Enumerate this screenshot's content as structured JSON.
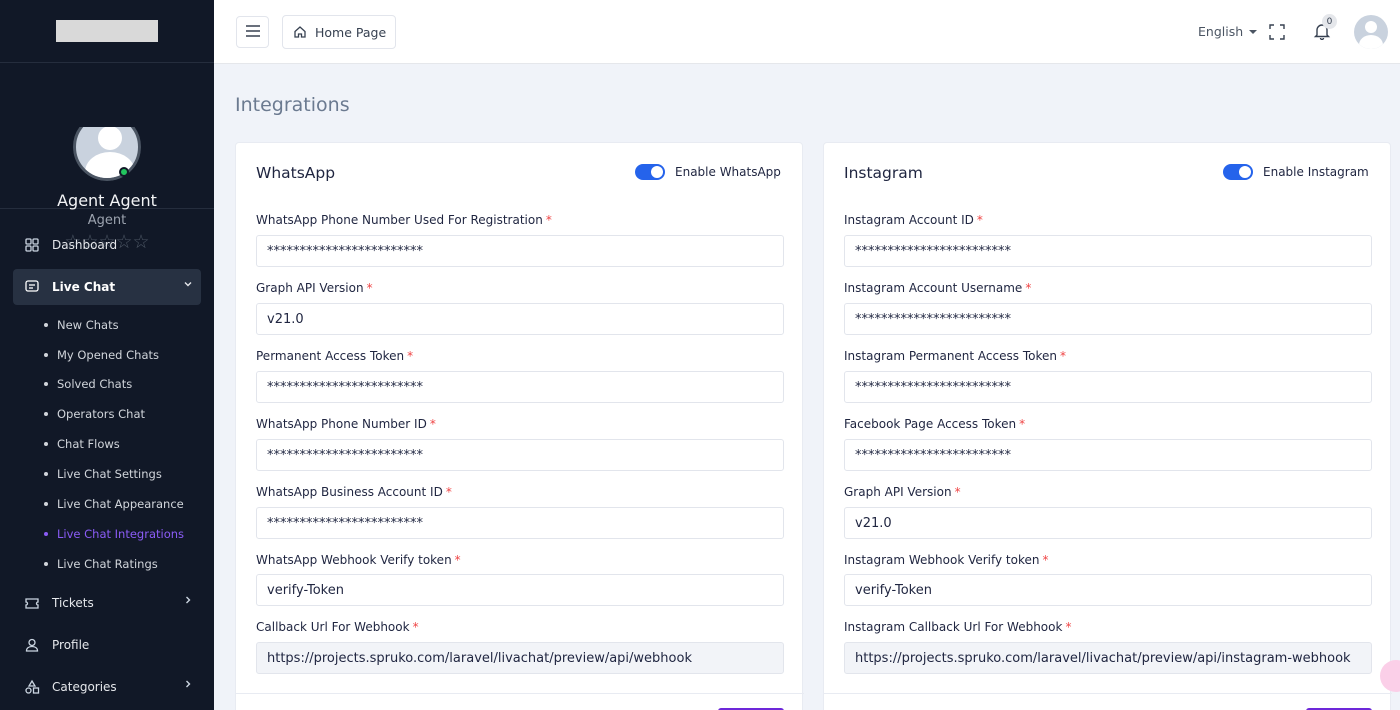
{
  "sidebar": {
    "profile": {
      "name": "Agent Agent",
      "role": "Agent",
      "rating": "☆☆☆☆☆"
    },
    "nav": {
      "dashboard": "Dashboard",
      "live_chat": "Live Chat",
      "tickets": "Tickets",
      "profile": "Profile",
      "categories": "Categories"
    },
    "live_chat_sub": [
      "New Chats",
      "My Opened Chats",
      "Solved Chats",
      "Operators Chat",
      "Chat Flows",
      "Live Chat Settings",
      "Live Chat Appearance",
      "Live Chat Integrations",
      "Live Chat Ratings"
    ]
  },
  "header": {
    "home_label": "Home Page",
    "language": "English",
    "notification_count": "0"
  },
  "page": {
    "title": "Integrations"
  },
  "whatsapp": {
    "title": "WhatsApp",
    "toggle_label": "Enable WhatsApp",
    "fields": [
      {
        "label": "WhatsApp Phone Number Used For Registration",
        "required": "*",
        "value": "************************"
      },
      {
        "label": "Graph API Version",
        "required": "*",
        "value": "v21.0"
      },
      {
        "label": "Permanent Access Token",
        "required": "*",
        "value": "************************"
      },
      {
        "label": "WhatsApp Phone Number ID",
        "required": "*",
        "value": "************************"
      },
      {
        "label": "WhatsApp Business Account ID",
        "required": "*",
        "value": "************************"
      },
      {
        "label": "WhatsApp Webhook Verify token",
        "required": "*",
        "value": "verify-Token"
      },
      {
        "label": "Callback Url For Webhook",
        "required": "*",
        "value": "https://projects.spruko.com/laravel/livachat/preview/api/webhook"
      }
    ]
  },
  "instagram": {
    "title": "Instagram",
    "toggle_label": "Enable Instagram",
    "fields": [
      {
        "label": "Instagram Account ID",
        "required": "*",
        "value": "************************"
      },
      {
        "label": "Instagram Account Username",
        "required": "*",
        "value": "************************"
      },
      {
        "label": "Instagram Permanent Access Token",
        "required": "*",
        "value": "************************"
      },
      {
        "label": "Facebook Page Access Token",
        "required": "*",
        "value": "************************"
      },
      {
        "label": "Graph API Version",
        "required": "*",
        "value": "v21.0"
      },
      {
        "label": "Instagram Webhook Verify token",
        "required": "*",
        "value": "verify-Token"
      },
      {
        "label": "Instagram Callback Url For Webhook",
        "required": "*",
        "value": "https://projects.spruko.com/laravel/livachat/preview/api/instagram-webhook"
      }
    ]
  },
  "colors": {
    "accent": "#8b5cf6",
    "toggle_on": "#2563eb",
    "sidebar_bg": "#111827"
  }
}
